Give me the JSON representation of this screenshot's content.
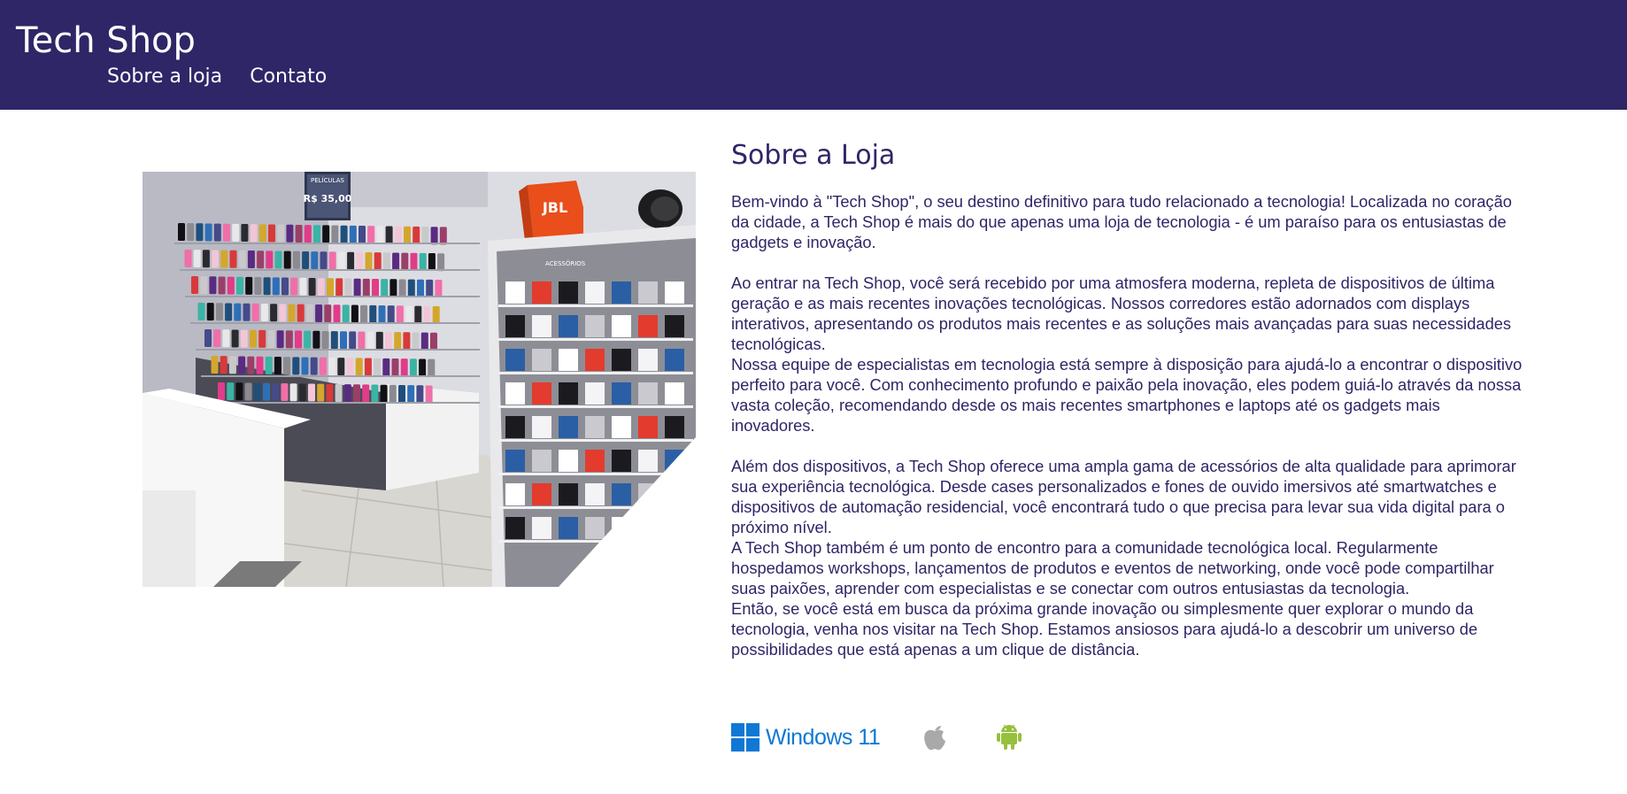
{
  "header": {
    "brand": "Tech Shop",
    "nav": [
      "Sobre a loja",
      "Contato"
    ],
    "background": "#2e2667"
  },
  "store_photo": {
    "alt": "Interior da loja com capas de celular e vitrine de acessórios",
    "sign_title": "PELÍCULAS",
    "sign_price": "R$ 35,00",
    "box_brand": "JBL",
    "cabinet_label": "ACESSÓRIOS"
  },
  "main": {
    "title": "Sobre a Loja",
    "paragraphs": [
      "Bem-vindo à \"Tech Shop\", o seu destino definitivo para tudo relacionado a tecnologia! Localizada no coração da cidade, a Tech Shop é mais do que apenas uma loja de tecnologia - é um paraíso para os entusiastas de gadgets e inovação.",
      "Ao entrar na Tech Shop, você será recebido por uma atmosfera moderna, repleta de dispositivos de última geração e as mais recentes inovações tecnológicas. Nossos corredores estão adornados com displays interativos, apresentando os produtos mais recentes e as soluções mais avançadas para suas necessidades tecnológicas.",
      "Nossa equipe de especialistas em tecnologia está sempre à disposição para ajudá-lo a encontrar o dispositivo perfeito para você. Com conhecimento profundo e paixão pela inovação, eles podem guiá-lo através da nossa vasta coleção, recomendando desde os mais recentes smartphones e laptops até os gadgets mais inovadores.",
      "Além dos dispositivos, a Tech Shop oferece uma ampla gama de acessórios de alta qualidade para aprimorar sua experiência tecnológica. Desde cases personalizados e fones de ouvido imersivos até smartwatches e dispositivos de automação residencial, você encontrará tudo o que precisa para levar sua vida digital para o próximo nível.",
      "A Tech Shop também é um ponto de encontro para a comunidade tecnológica local. Regularmente hospedamos workshops, lançamentos de produtos e eventos de networking, onde você pode compartilhar suas paixões, aprender com especialistas e se conectar com outros entusiastas da tecnologia.",
      "Então, se você está em busca da próxima grande inovação ou simplesmente quer explorar o mundo da tecnologia, venha nos visitar na Tech Shop. Estamos ansiosos para ajudá-lo a descobrir um universo de possibilidades que está apenas a um clique de distância."
    ]
  },
  "platforms": {
    "windows_label": "Windows 11",
    "icons": [
      "windows-logo-icon",
      "apple-logo-icon",
      "android-logo-icon"
    ],
    "colors": {
      "windows": "#0f78d4",
      "apple": "#a9a9a9",
      "android": "#97c03d"
    }
  }
}
